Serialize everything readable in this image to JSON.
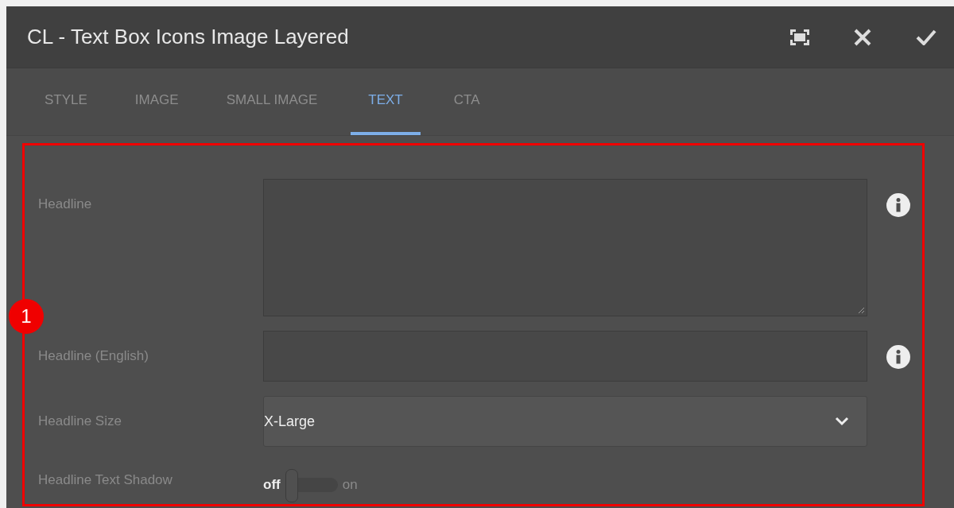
{
  "window": {
    "title": "CL - Text Box Icons Image Layered"
  },
  "tabs": [
    {
      "label": "STYLE",
      "selected": false
    },
    {
      "label": "IMAGE",
      "selected": false
    },
    {
      "label": "SMALL IMAGE",
      "selected": false
    },
    {
      "label": "TEXT",
      "selected": true
    },
    {
      "label": "CTA",
      "selected": false
    }
  ],
  "annotation": {
    "number": "1"
  },
  "fields": [
    {
      "kind": "textarea",
      "label": "Headline",
      "info": true
    },
    {
      "kind": "text",
      "label": "Headline (English)",
      "info": true
    },
    {
      "kind": "select",
      "label": "Headline Size",
      "value": "X-Large",
      "info": false
    },
    {
      "kind": "toggle",
      "label": "Headline Text Shadow",
      "off_label": "off",
      "on_label": "on",
      "on": false,
      "info": false
    }
  ]
}
